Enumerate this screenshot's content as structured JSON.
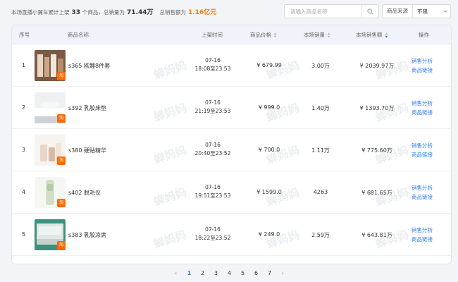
{
  "summary": {
    "prefix": "本场直播小翼车累计上架",
    "product_count": "33",
    "mid1": "个商品，总销量为",
    "total_sales": "71.44万",
    "mid2": "总销售额为",
    "total_amount": "1.16亿元"
  },
  "search": {
    "placeholder": "请输入商品名称",
    "value": ""
  },
  "filter": {
    "label": "商品来源",
    "value": "不限"
  },
  "columns": {
    "seq": "序号",
    "name": "商品名称",
    "time": "上架时间",
    "price": "商品价格",
    "sales": "本场销量",
    "amount": "本场销售额",
    "ops": "操作"
  },
  "watermark": "蝉妈妈",
  "badge": "淘",
  "rows": [
    {
      "seq": "1",
      "name": "s365 欧趣8件套",
      "date": "07-16",
      "time": "18:08至23:53",
      "price": "¥ 679.99",
      "sales": "3.00万",
      "amount": "¥ 2039.97万",
      "op1": "销售分析",
      "op2": "商品链接"
    },
    {
      "seq": "2",
      "name": "s392 乳胶床垫",
      "date": "07-16",
      "time": "21:19至23:53",
      "price": "¥ 999.0",
      "sales": "1.40万",
      "amount": "¥ 1393.70万",
      "op1": "销售分析",
      "op2": "商品链接"
    },
    {
      "seq": "3",
      "name": "s380 硬贴精华",
      "date": "07-16",
      "time": "20:40至23:52",
      "price": "¥ 700.0",
      "sales": "1.11万",
      "amount": "¥ 775.60万",
      "op1": "销售分析",
      "op2": "商品链接"
    },
    {
      "seq": "4",
      "name": "s402 脱毛仪",
      "date": "07-16",
      "time": "19:51至23:53",
      "price": "¥ 1599.0",
      "sales": "4263",
      "amount": "¥ 681.65万",
      "op1": "销售分析",
      "op2": "商品链接"
    },
    {
      "seq": "5",
      "name": "s383 乳胶凉席",
      "date": "07-16",
      "time": "18:22至23:52",
      "price": "¥ 249.0",
      "sales": "2.59万",
      "amount": "¥ 643.81万",
      "op1": "销售分析",
      "op2": "商品链接"
    }
  ],
  "pagination": {
    "prev": "‹",
    "pages": [
      "1",
      "2",
      "3",
      "4",
      "5",
      "6",
      "7"
    ],
    "current": "1",
    "next": "›"
  },
  "colors": {
    "accent": "#2f7cf6",
    "highlight": "#ff7a00",
    "badge": "#ff6a00"
  }
}
